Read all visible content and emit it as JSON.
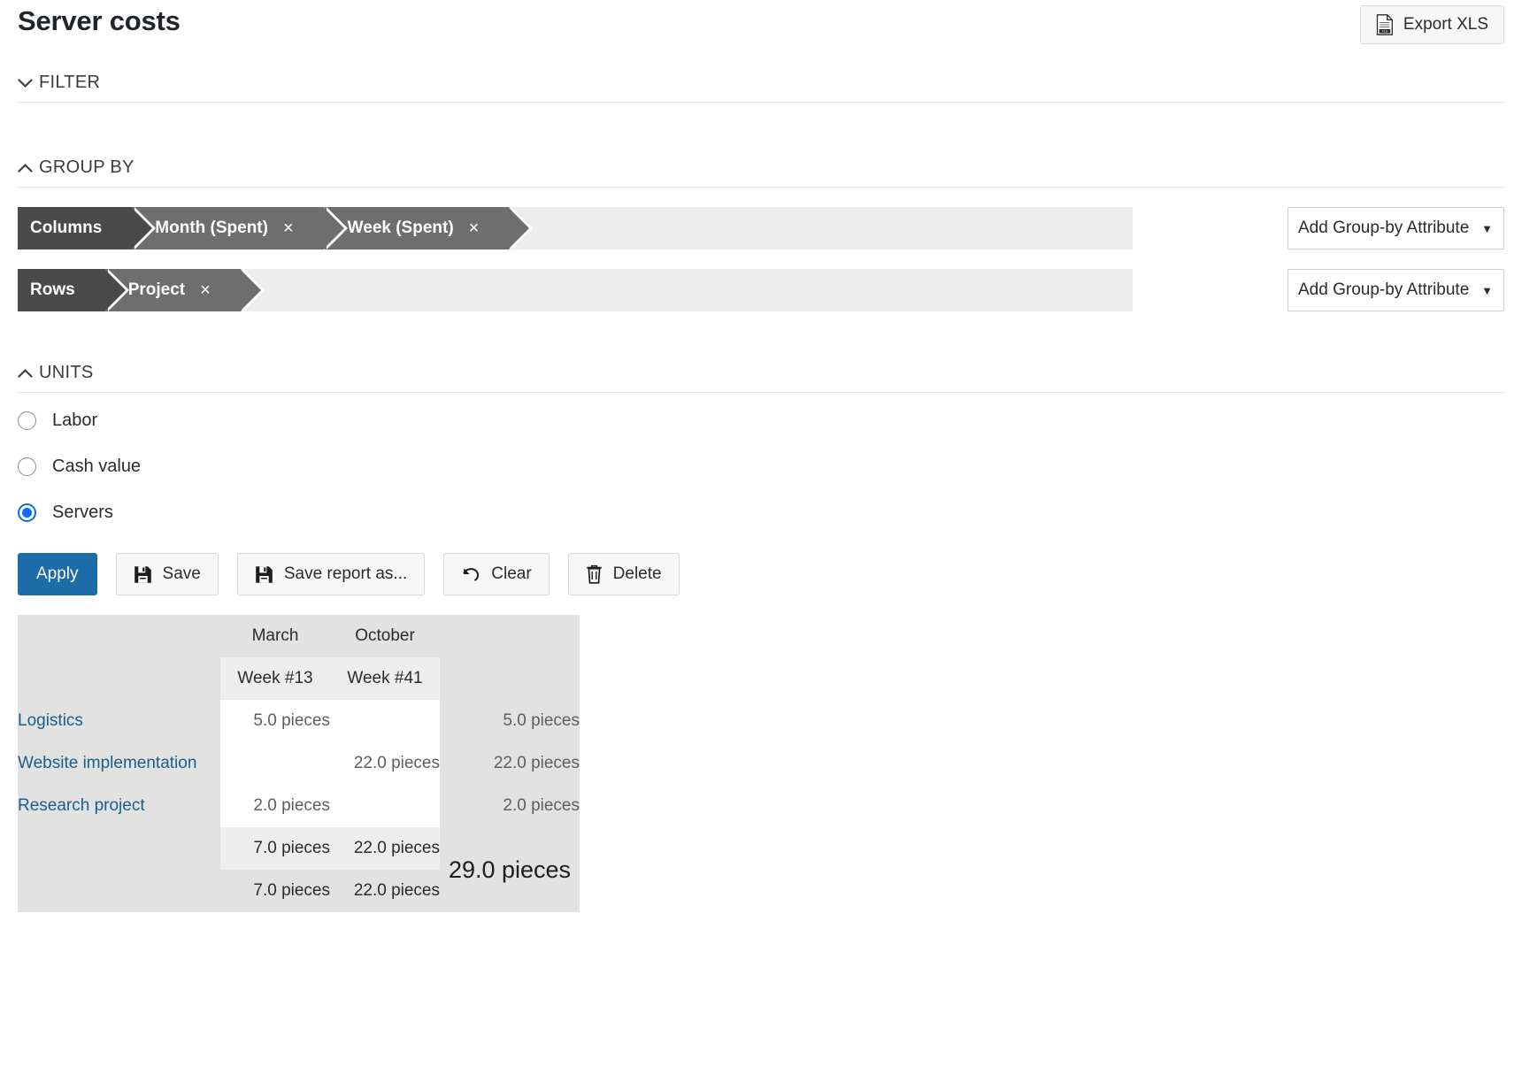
{
  "header": {
    "title": "Server costs",
    "export_label": "Export XLS",
    "export_icon": "xls-document-icon"
  },
  "sections": {
    "filter": {
      "label": "FILTER",
      "chevron": "chevron-down-icon",
      "expanded": false
    },
    "group_by": {
      "label": "GROUP BY",
      "chevron": "chevron-up-icon",
      "expanded": true
    },
    "units": {
      "label": "UNITS",
      "chevron": "chevron-up-icon",
      "expanded": true
    }
  },
  "group_by": {
    "columns": {
      "key_label": "Columns",
      "chips": [
        {
          "label": "Month (Spent)",
          "remove": "×"
        },
        {
          "label": "Week (Spent)",
          "remove": "×"
        }
      ],
      "add_label": "Add Group-by Attribute",
      "caret": "▼"
    },
    "rows": {
      "key_label": "Rows",
      "chips": [
        {
          "label": "Project",
          "remove": "×"
        }
      ],
      "add_label": "Add Group-by Attribute",
      "caret": "▼"
    }
  },
  "units": {
    "options": [
      {
        "label": "Labor",
        "selected": false
      },
      {
        "label": "Cash value",
        "selected": false
      },
      {
        "label": "Servers",
        "selected": true
      }
    ],
    "selected_color": "#0d6efd"
  },
  "actions": {
    "apply": {
      "label": "Apply",
      "primary_color": "#1b6ca8"
    },
    "save": {
      "label": "Save",
      "icon": "floppy-disk-icon"
    },
    "save_as": {
      "label": "Save report as...",
      "icon": "floppy-disk-icon"
    },
    "clear": {
      "label": "Clear",
      "icon": "undo-arrow-icon"
    },
    "delete": {
      "label": "Delete",
      "icon": "trash-icon"
    }
  },
  "pivot": {
    "month_headers": [
      "March",
      "October"
    ],
    "week_headers": [
      "Week #13",
      "Week #41"
    ],
    "rows": [
      {
        "label": "Logistics",
        "values": [
          "5.0 pieces",
          ""
        ],
        "total": "5.0 pieces"
      },
      {
        "label": "Website implementation",
        "values": [
          "",
          "22.0 pieces"
        ],
        "total": "22.0 pieces"
      },
      {
        "label": "Research project",
        "values": [
          "2.0 pieces",
          ""
        ],
        "total": "2.0 pieces"
      }
    ],
    "week_totals": [
      "7.0 pieces",
      "22.0 pieces"
    ],
    "month_totals": [
      "7.0 pieces",
      "22.0 pieces"
    ],
    "grand_total": "29.0 pieces"
  }
}
